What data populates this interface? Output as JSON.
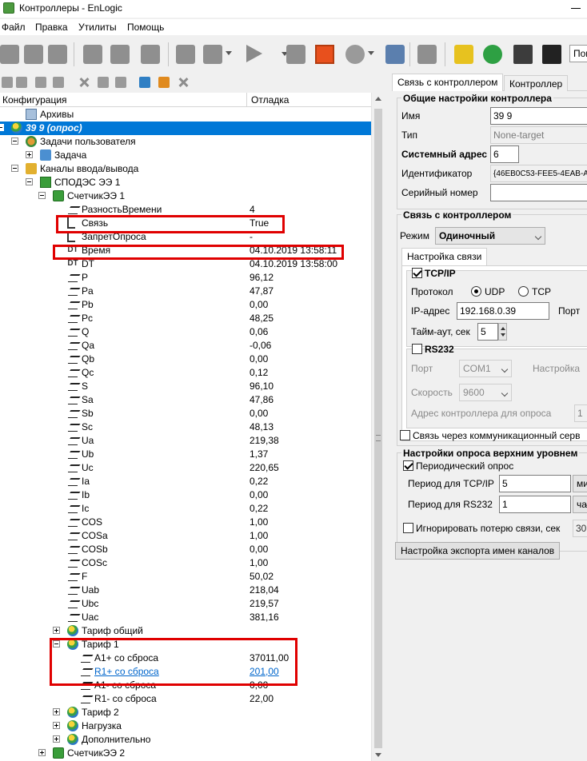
{
  "window": {
    "title": "Контроллеры - EnLogic"
  },
  "menu": [
    "Файл",
    "Правка",
    "Утилиты",
    "Помощь"
  ],
  "toolbar": {
    "search_placeholder": "Пои"
  },
  "tree": {
    "columns": {
      "config": "Конфигурация",
      "debug": "Отладка"
    },
    "rows": [
      {
        "label": "Архивы",
        "value": ""
      },
      {
        "label": "39 9 (опрос)",
        "value": ""
      },
      {
        "label": "Задачи пользователя",
        "value": ""
      },
      {
        "label": "Задача",
        "value": ""
      },
      {
        "label": "Каналы ввода/вывода",
        "value": ""
      },
      {
        "label": "СПОДЭС ЭЭ 1",
        "value": ""
      },
      {
        "label": "СчетчикЭЭ 1",
        "value": ""
      },
      {
        "label": "РазностьВремени",
        "value": "4"
      },
      {
        "label": "Связь",
        "value": "True"
      },
      {
        "label": "ЗапретОпроса",
        "value": "-"
      },
      {
        "label": "Время",
        "value": "04.10.2019 13:58:11"
      },
      {
        "label": "DT",
        "value": "04.10.2019 13:58:00"
      },
      {
        "label": "P",
        "value": "96,12"
      },
      {
        "label": "Pa",
        "value": "47,87"
      },
      {
        "label": "Pb",
        "value": "0,00"
      },
      {
        "label": "Pc",
        "value": "48,25"
      },
      {
        "label": "Q",
        "value": "0,06"
      },
      {
        "label": "Qa",
        "value": "-0,06"
      },
      {
        "label": "Qb",
        "value": "0,00"
      },
      {
        "label": "Qc",
        "value": "0,12"
      },
      {
        "label": "S",
        "value": "96,10"
      },
      {
        "label": "Sa",
        "value": "47,86"
      },
      {
        "label": "Sb",
        "value": "0,00"
      },
      {
        "label": "Sc",
        "value": "48,13"
      },
      {
        "label": "Ua",
        "value": "219,38"
      },
      {
        "label": "Ub",
        "value": "1,37"
      },
      {
        "label": "Uc",
        "value": "220,65"
      },
      {
        "label": "Ia",
        "value": "0,22"
      },
      {
        "label": "Ib",
        "value": "0,00"
      },
      {
        "label": "Ic",
        "value": "0,22"
      },
      {
        "label": "COS",
        "value": "1,00"
      },
      {
        "label": "COSa",
        "value": "1,00"
      },
      {
        "label": "COSb",
        "value": "0,00"
      },
      {
        "label": "COSc",
        "value": "1,00"
      },
      {
        "label": "F",
        "value": "50,02"
      },
      {
        "label": "Uab",
        "value": "218,04"
      },
      {
        "label": "Ubc",
        "value": "219,57"
      },
      {
        "label": "Uac",
        "value": "381,16"
      },
      {
        "label": "Тариф общий",
        "value": ""
      },
      {
        "label": "Тариф 1",
        "value": ""
      },
      {
        "label": "A1+ со сброса",
        "value": "37011,00"
      },
      {
        "label": "R1+ со сброса",
        "value": "201,00"
      },
      {
        "label": "A1- со сброса",
        "value": "0,00"
      },
      {
        "label": "R1- со сброса",
        "value": "22,00"
      },
      {
        "label": "Тариф 2",
        "value": ""
      },
      {
        "label": "Нагрузка",
        "value": ""
      },
      {
        "label": "Дополнительно",
        "value": ""
      },
      {
        "label": "СчетчикЭЭ 2",
        "value": ""
      }
    ]
  },
  "right": {
    "tabs": [
      "Связь с контроллером",
      "Контроллер"
    ],
    "general": {
      "title": "Общие настройки контроллера",
      "name_label": "Имя",
      "name_value": "39 9",
      "type_label": "Тип",
      "type_value": "None-target",
      "sysaddr_label": "Системный адрес",
      "sysaddr_value": "6",
      "id_label": "Идентификатор",
      "id_value": "{46EB0C53-FEE5-4EAB-AB4",
      "serial_label": "Серийный номер",
      "serial_value": ""
    },
    "link": {
      "title": "Связь с контроллером",
      "mode_label": "Режим",
      "mode_value": "Одиночный",
      "subtab": "Настройка связи",
      "tcpip_label": "TCP/IP",
      "protocol_label": "Протокол",
      "udp": "UDP",
      "tcp": "TCP",
      "ip_label": "IP-адрес",
      "ip_value": "192.168.0.39",
      "port_label": "Порт",
      "timeout_label": "Тайм-аут, сек",
      "timeout_value": "5",
      "rs232_label": "RS232",
      "port2_label": "Порт",
      "port2_value": "COM1",
      "settings_label": "Настройка",
      "speed_label": "Скорость",
      "speed_value": "9600",
      "addr_label": "Адрес контроллера для опроса",
      "addr_value": "1",
      "comm_label": "Связь через коммуникационный серв"
    },
    "poll": {
      "title": "Настройки опроса верхним уровнем",
      "periodic_label": "Периодический опрос",
      "tcp_period_label": "Период для TCP/IP",
      "tcp_period_value": "5",
      "tcp_unit": "ми",
      "rs_period_label": "Период для RS232",
      "rs_period_value": "1",
      "rs_unit": "ча",
      "ignore_label": "Игнорировать потерю связи, сек",
      "ignore_value": "30"
    },
    "export_button": "Настройка экспорта имен каналов"
  }
}
